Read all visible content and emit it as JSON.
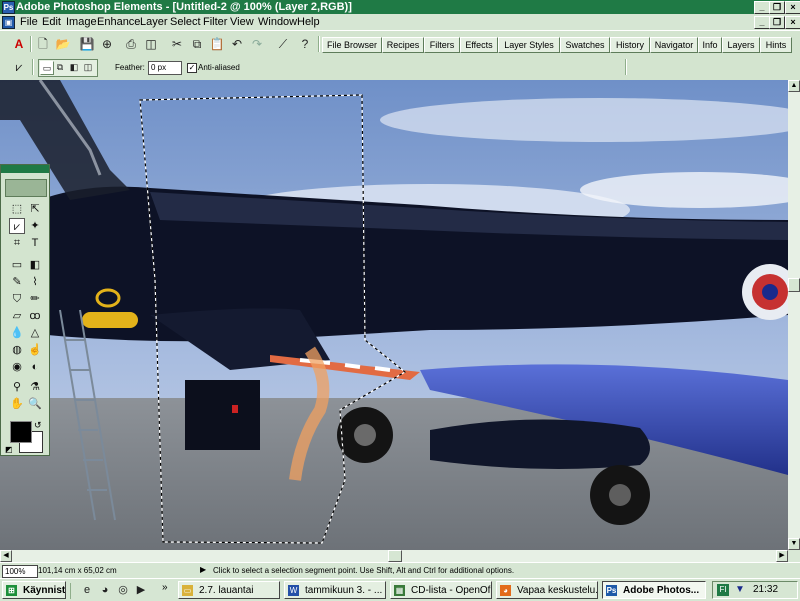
{
  "titlebar": {
    "title": "Adobe Photoshop Elements - [Untitled-2 @ 100% (Layer 2,RGB)]"
  },
  "menubar": {
    "items": [
      "File",
      "Edit",
      "Image",
      "Enhance",
      "Layer",
      "Select",
      "Filter",
      "View",
      "Window",
      "Help"
    ]
  },
  "palette_tabs": [
    "File Browser",
    "Recipes",
    "Filters",
    "Effects",
    "Layer Styles",
    "Swatches",
    "History",
    "Navigator",
    "Info",
    "Layers",
    "Hints"
  ],
  "options": {
    "feather_label": "Feather:",
    "feather_value": "0 px",
    "antialiased_label": "Anti-aliased",
    "antialiased_checked": true
  },
  "status": {
    "zoom": "100%",
    "doc_size": "101,14 cm x 65,02 cm",
    "message": "Click to select a selection segment point.  Use Shift, Alt and Ctrl for additional options."
  },
  "taskbar": {
    "start_label": "Käynnistä",
    "tasks": [
      {
        "label": "2.7. lauantai",
        "icon": "folder-icon"
      },
      {
        "label": "tammikuun 3. - ...",
        "icon": "word-icon"
      },
      {
        "label": "CD-lista - OpenOf...",
        "icon": "openoffice-icon"
      },
      {
        "label": "Vapaa keskustelu...",
        "icon": "firefox-icon"
      },
      {
        "label": "Adobe Photos...",
        "icon": "photoshop-icon",
        "active": true
      }
    ],
    "clock": "21:32",
    "tray_lang": "FI"
  },
  "colors": {
    "title_green": "#1f7a45",
    "chrome": "#d6e6d3",
    "foreground_color": "#000000",
    "background_color": "#ffffff"
  }
}
